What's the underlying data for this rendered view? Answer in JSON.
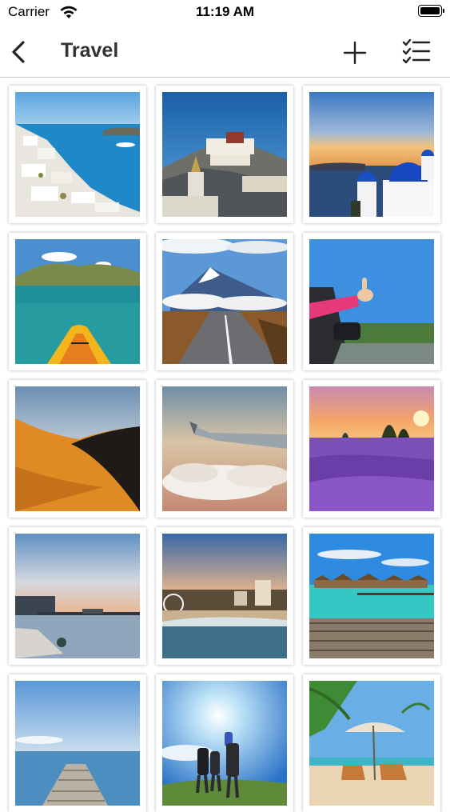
{
  "status_bar": {
    "carrier": "Carrier",
    "time": "11:19 AM",
    "icons": [
      "wifi-icon",
      "battery-icon"
    ]
  },
  "nav": {
    "title": "Travel",
    "icons": [
      "back-chevron-icon",
      "plus-icon",
      "checklist-icon"
    ]
  },
  "photos": [
    "santorini-white-village",
    "potala-palace",
    "santorini-blue-domes",
    "kayak-lagoon",
    "mountain-road",
    "thumbs-up-car-window",
    "desert-dunes",
    "airplane-wing-clouds",
    "lavender-field-sunset",
    "pier-sunset",
    "beach-city-ferris-wheel",
    "overwater-bungalows",
    "wooden-jetty-sea",
    "hikers-sunburst",
    "beach-umbrella-chairs"
  ],
  "colors": {
    "text": "#000000",
    "title": "#333333",
    "separator": "#c8c8c8",
    "card_shadow": "rgba(0,0,0,0.28)"
  }
}
